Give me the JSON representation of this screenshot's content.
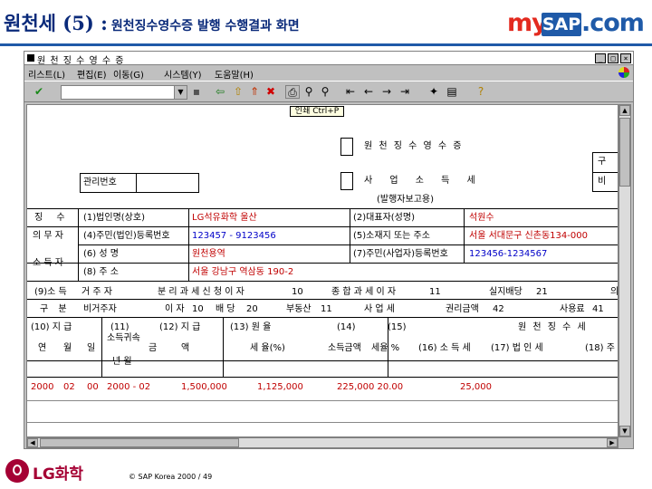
{
  "slide": {
    "title_main": "원천세 (5) :",
    "title_sub": "원천징수영수증 발행 수행결과 화면",
    "brand_my": "my",
    "brand_sap": "SAP",
    "brand_com": ".com",
    "footer_company": "LG화학",
    "copyright": "©  SAP Korea 2000 /  49"
  },
  "window": {
    "title": "원 천 징 수 영 수 증",
    "min_label": "_",
    "restore_label": "□",
    "close_label": "×"
  },
  "menu": [
    {
      "label": "리스트(L)"
    },
    {
      "label": "편집(E)"
    },
    {
      "label": "이동(G)"
    },
    {
      "label": "시스템(Y)"
    },
    {
      "label": "도움말(H)"
    }
  ],
  "toolbar": {
    "tooltip": "인쇄  Ctrl+P"
  },
  "form": {
    "checkbox_labels": [
      "원 천 징 수 영 수 증",
      "사 업 소 득 세"
    ],
    "right_marks": [
      "구",
      "비"
    ],
    "manage_no_label": "관리번호",
    "issuer_note": "(발행자보고용)",
    "rows": [
      {
        "label": "징 수",
        "f1": "(1)법인명(상호)",
        "v1": "LG석유화학 울산",
        "f2": "(2)대표자(성명)",
        "v2": "석원수"
      },
      {
        "label": "의 무 자",
        "f1": "(4)주민(법인)등록번호",
        "v1": "123457 - 9123456",
        "f2": "(5)소재지 또는 주소",
        "v2": "서울 서대문구 신촌동134-000"
      },
      {
        "label": "",
        "f1": "(6) 성          명",
        "v1": "원천용역",
        "f2": "(7)주민(사업자)등록번호",
        "v2": "123456-1234567"
      },
      {
        "label": "소 득 자",
        "f1": "(8) 주          소",
        "v1": "서울 강남구 역삼동 190-2",
        "f2": "",
        "v2": ""
      }
    ],
    "income_line": {
      "label": "(9)소 득",
      "resident": "거 주 자",
      "separate": "분 리 과 세 신 청 이 자",
      "v1": "10",
      "global": "종 합 과 세 이 자",
      "v2": "11",
      "dividend": "실지배당",
      "v3": "21",
      "tail": "의"
    },
    "kind_line": {
      "label": "구 분",
      "nonres": "비거주자",
      "interest": "이 자",
      "v1": "10",
      "div": "배 당",
      "v2": "20",
      "realestate": "부동산",
      "v3": "11",
      "misc": "사 업 세",
      "rights": "권리금액",
      "v4": "42",
      "prize": "사용료",
      "v5": "41"
    },
    "col_headers_top": [
      "(10) 지  급",
      "(11)",
      "(12) 지  급",
      "(13) 원  율",
      "(14)",
      "(15)",
      "원 천 징 수 세"
    ],
    "col_headers_sub": [
      "소득귀속",
      "연",
      "월",
      "일",
      "금",
      "액",
      "세 율(%)",
      "소득금액",
      "세율 %",
      "(16) 소 득 세",
      "(17) 법 인 세",
      "(18) 주"
    ],
    "col_headers_row3": [
      "년  월"
    ],
    "data_row": {
      "year": "2000",
      "month": "02",
      "day": "00",
      "period": "2000 - 02",
      "amount": "1,500,000",
      "tax_base": "1,125,000",
      "income_amount": "225,000 20.00",
      "income_tax": "25,000"
    }
  }
}
